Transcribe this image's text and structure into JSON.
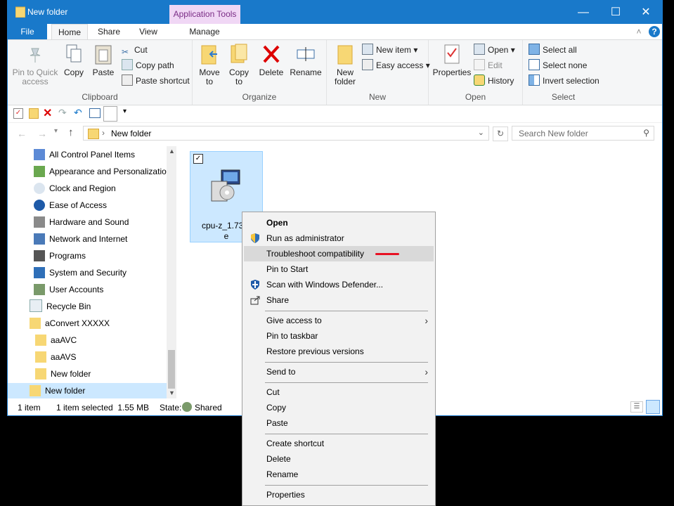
{
  "window": {
    "title": "New folder",
    "context_tab": "Application Tools",
    "controls": {
      "minimize": "—",
      "maximize": "☐",
      "close": "✕"
    }
  },
  "tabs": {
    "file": "File",
    "home": "Home",
    "share": "Share",
    "view": "View",
    "manage": "Manage"
  },
  "ribbon": {
    "clipboard": {
      "label": "Clipboard",
      "pin": "Pin to Quick access",
      "copy": "Copy",
      "paste": "Paste",
      "cut": "Cut",
      "copy_path": "Copy path",
      "paste_shortcut": "Paste shortcut"
    },
    "organize": {
      "label": "Organize",
      "move_to": "Move to",
      "copy_to": "Copy to",
      "delete": "Delete",
      "rename": "Rename"
    },
    "new": {
      "label": "New",
      "new_folder": "New folder",
      "new_item": "New item",
      "easy_access": "Easy access"
    },
    "open": {
      "label": "Open",
      "properties": "Properties",
      "open": "Open",
      "edit": "Edit",
      "history": "History"
    },
    "select": {
      "label": "Select",
      "select_all": "Select all",
      "select_none": "Select none",
      "invert": "Invert selection"
    }
  },
  "address": {
    "path": "New folder",
    "search_placeholder": "Search New folder"
  },
  "nav": {
    "items": [
      {
        "label": "All Control Panel Items"
      },
      {
        "label": "Appearance and Personalizatio"
      },
      {
        "label": "Clock and Region"
      },
      {
        "label": "Ease of Access"
      },
      {
        "label": "Hardware and Sound"
      },
      {
        "label": "Network and Internet"
      },
      {
        "label": "Programs"
      },
      {
        "label": "System and Security"
      },
      {
        "label": "User Accounts"
      },
      {
        "label": "Recycle Bin"
      },
      {
        "label": "aConvert XXXXX"
      },
      {
        "label": "aaAVC"
      },
      {
        "label": "aaAVS"
      },
      {
        "label": "New folder"
      },
      {
        "label": "New folder"
      }
    ]
  },
  "file": {
    "name_line1": "cpu-z_1.73-e",
    "name_line2": "e"
  },
  "status": {
    "count": "1 item",
    "selected": "1 item selected  1.55 MB",
    "state_label": "State:",
    "state_value": "Shared"
  },
  "context_menu": {
    "items": [
      {
        "label": "Open"
      },
      {
        "label": "Run as administrator"
      },
      {
        "label": "Troubleshoot compatibility"
      },
      {
        "label": "Pin to Start"
      },
      {
        "label": "Scan with Windows Defender..."
      },
      {
        "label": "Share"
      },
      {
        "label": "Give access to"
      },
      {
        "label": "Pin to taskbar"
      },
      {
        "label": "Restore previous versions"
      },
      {
        "label": "Send to"
      },
      {
        "label": "Cut"
      },
      {
        "label": "Copy"
      },
      {
        "label": "Paste"
      },
      {
        "label": "Create shortcut"
      },
      {
        "label": "Delete"
      },
      {
        "label": "Rename"
      },
      {
        "label": "Properties"
      }
    ]
  },
  "colors": {
    "accent": "#1979ca",
    "selection": "#cce8ff",
    "highlight": "#d9d9d9",
    "annotation": "#e81123"
  }
}
